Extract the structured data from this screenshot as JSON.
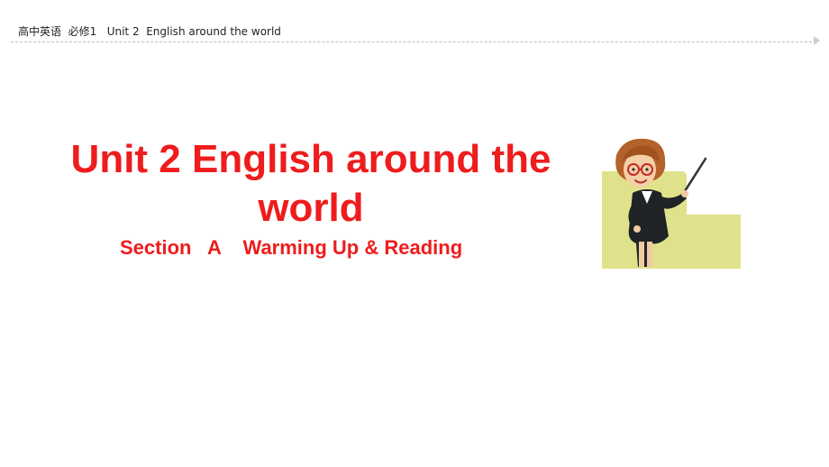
{
  "header": {
    "breadcrumb": "高中英语  必修1   Unit 2  English around the world"
  },
  "slide": {
    "title": "Unit 2  English around the world",
    "subtitle": "Section   A    Warming Up & Reading"
  },
  "colors": {
    "title": "#ee1c1c",
    "header_text": "#222222",
    "divider": "#b7bcc8",
    "backdrop": "#dfe28a"
  },
  "illustration": {
    "icon": "teacher-with-pointer-icon"
  }
}
